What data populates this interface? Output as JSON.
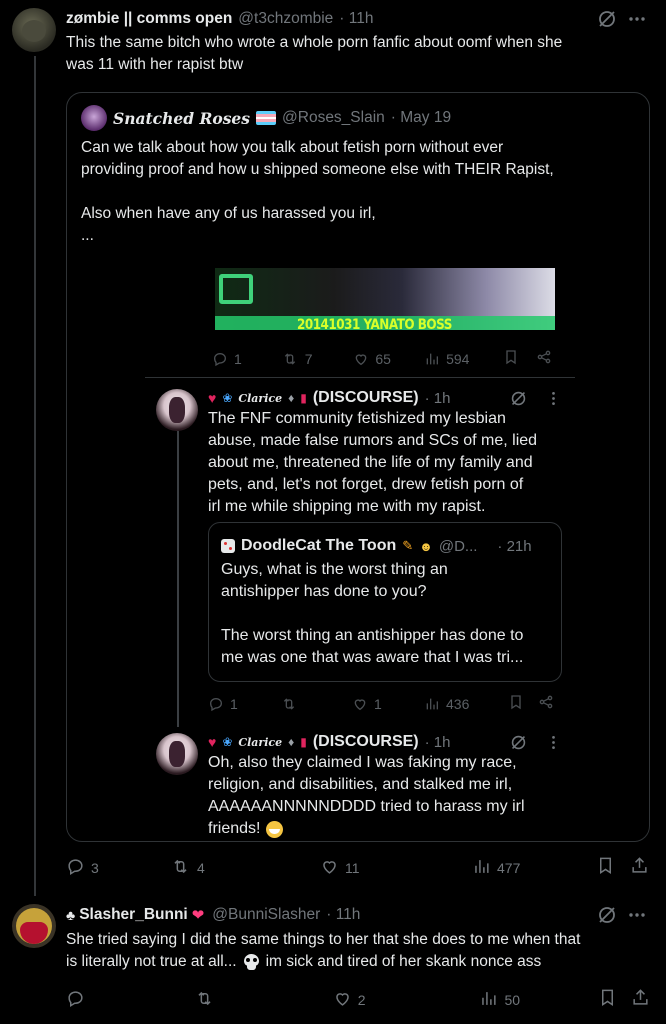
{
  "post1": {
    "display_name": "zømbie || comms open",
    "handle": "@t3chzombie",
    "time": "· 11h",
    "text_line1": "This the same bitch who wrote a whole porn fanfic about oomf when she",
    "text_line2": "was 11 with her rapist btw",
    "stats": {
      "replies": "3",
      "reposts": "4",
      "likes": "11",
      "views": "477"
    }
  },
  "quote": {
    "display_name": "Snatched Roses",
    "handle": "@Roses_Slain",
    "time": "· May 19",
    "text_line1": "Can we talk about how you talk about fetish porn without ever",
    "text_line2": "providing proof and how u shipped someone else with THEIR Rapist,",
    "text_line3": "Also when have any of us harassed you irl,",
    "text_line4": "...",
    "image": {
      "banner_text": "20141031 YANATO BOSS",
      "stats": {
        "replies": "1",
        "reposts": "7",
        "likes": "65",
        "views": "594"
      },
      "reply1": {
        "display_name": "(DISCOURSE)",
        "time": "· 1h",
        "lines": [
          "The FNF community fetishized my lesbian",
          "abuse, made false rumors and SCs of me, lied",
          "about me, threatened the life of my family and",
          "pets, and, let's not forget, drew fetish porn of",
          "irl me while shipping me with my rapist."
        ],
        "quoted": {
          "display_name": "DoodleCat The Toon",
          "handle": "@D...",
          "time": "· 21h",
          "line1": "Guys, what is the worst thing an",
          "line2": "antishipper has done to you?",
          "line3": "The worst thing an antishipper has done to",
          "line4": "me was one that was aware that I was tri..."
        },
        "stats": {
          "replies": "1",
          "reposts": "",
          "likes": "1",
          "views": "436"
        }
      },
      "reply2": {
        "display_name": "(DISCOURSE)",
        "time": "· 1h",
        "lines": [
          "Oh, also they claimed I was faking my race,",
          "religion, and disabilities, and stalked me irl,",
          "AAAAAANNNNNDDDD tried to harass my irl",
          "friends!"
        ]
      }
    }
  },
  "post2": {
    "display_name": "Slasher_Bunni",
    "handle": "@BunniSlasher",
    "time": "· 11h",
    "text_line1": "She tried saying I did the same things to her that she does to me when that",
    "text_line2": "is literally not true at all...",
    "text_line2b": "im sick and tired of her skank nonce ass",
    "stats": {
      "replies": "",
      "reposts": "",
      "likes": "2",
      "views": "50"
    }
  },
  "colors": {
    "bg": "#000000",
    "text": "#e7e9ea",
    "muted": "#71767b",
    "border": "#2f3336"
  },
  "icons": [
    "grok-icon",
    "more-icon",
    "reply-icon",
    "repost-icon",
    "like-icon",
    "views-icon",
    "bookmark-icon",
    "share-icon",
    "skull-icon",
    "grin-icon",
    "cat-icon",
    "pencil-icon",
    "bunny-icon",
    "heart-icon"
  ]
}
